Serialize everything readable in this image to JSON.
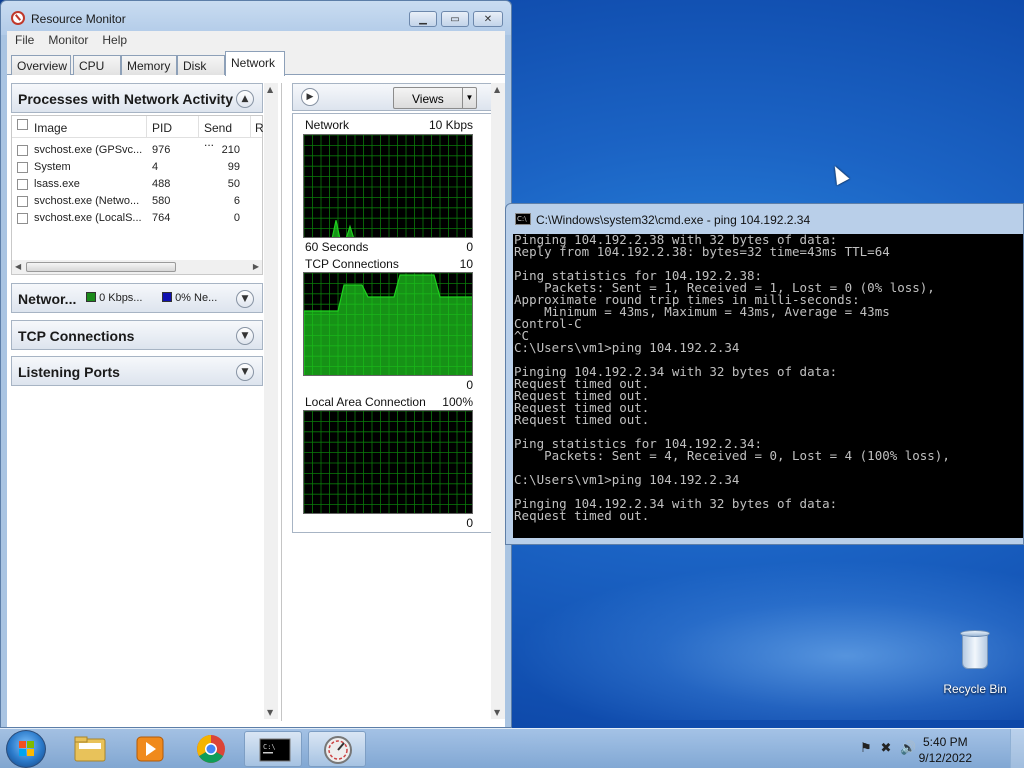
{
  "resource_monitor": {
    "title": "Resource Monitor",
    "menu": [
      "File",
      "Monitor",
      "Help"
    ],
    "tabs": [
      "Overview",
      "CPU",
      "Memory",
      "Disk",
      "Network"
    ],
    "active_tab": "Network",
    "processes": {
      "section_title": "Processes with Network Activity",
      "columns": {
        "image": "Image",
        "pid": "PID",
        "send": "Send ...",
        "r": "R"
      },
      "rows": [
        {
          "image": "svchost.exe (GPSvc...",
          "pid": "976",
          "send": "210"
        },
        {
          "image": "System",
          "pid": "4",
          "send": "99"
        },
        {
          "image": "lsass.exe",
          "pid": "488",
          "send": "50"
        },
        {
          "image": "svchost.exe (Netwo...",
          "pid": "580",
          "send": "6"
        },
        {
          "image": "svchost.exe (LocalS...",
          "pid": "764",
          "send": "0"
        }
      ]
    },
    "network_section": {
      "label": "Networ...",
      "kbps": "0 Kbps...",
      "percent": "0% Ne...",
      "kbps_color": "#1a8a1a",
      "percent_color": "#1010b0"
    },
    "tcp_section": "TCP Connections",
    "listening_section": "Listening Ports",
    "views_button": "Views",
    "graphs": {
      "network": {
        "title": "Network",
        "max": "10 Kbps",
        "xlabel": "60 Seconds",
        "min": "0",
        "peaks": [
          0.18,
          0.12
        ]
      },
      "tcp": {
        "title": "TCP Connections",
        "max": "10",
        "min": "0"
      },
      "lan": {
        "title": "Local Area Connection",
        "max": "100%",
        "min": "0"
      }
    },
    "accent_green": "#1fd01f"
  },
  "cmd": {
    "title": "C:\\Windows\\system32\\cmd.exe - ping  104.192.2.34",
    "lines": [
      "Pinging 104.192.2.38 with 32 bytes of data:",
      "Reply from 104.192.2.38: bytes=32 time=43ms TTL=64",
      "",
      "Ping statistics for 104.192.2.38:",
      "    Packets: Sent = 1, Received = 1, Lost = 0 (0% loss),",
      "Approximate round trip times in milli-seconds:",
      "    Minimum = 43ms, Maximum = 43ms, Average = 43ms",
      "Control-C",
      "^C",
      "C:\\Users\\vm1>ping 104.192.2.34",
      "",
      "Pinging 104.192.2.34 with 32 bytes of data:",
      "Request timed out.",
      "Request timed out.",
      "Request timed out.",
      "Request timed out.",
      "",
      "Ping statistics for 104.192.2.34:",
      "    Packets: Sent = 4, Received = 0, Lost = 4 (100% loss),",
      "",
      "C:\\Users\\vm1>ping 104.192.2.34",
      "",
      "Pinging 104.192.2.34 with 32 bytes of data:",
      "Request timed out."
    ]
  },
  "desktop": {
    "recycle_bin": "Recycle Bin"
  },
  "taskbar": {
    "items": [
      "start-button",
      "explorer-icon",
      "media-player-icon",
      "chrome-icon",
      "cmd-icon",
      "resource-monitor-icon"
    ],
    "time": "5:40 PM",
    "date": "9/12/2022"
  }
}
